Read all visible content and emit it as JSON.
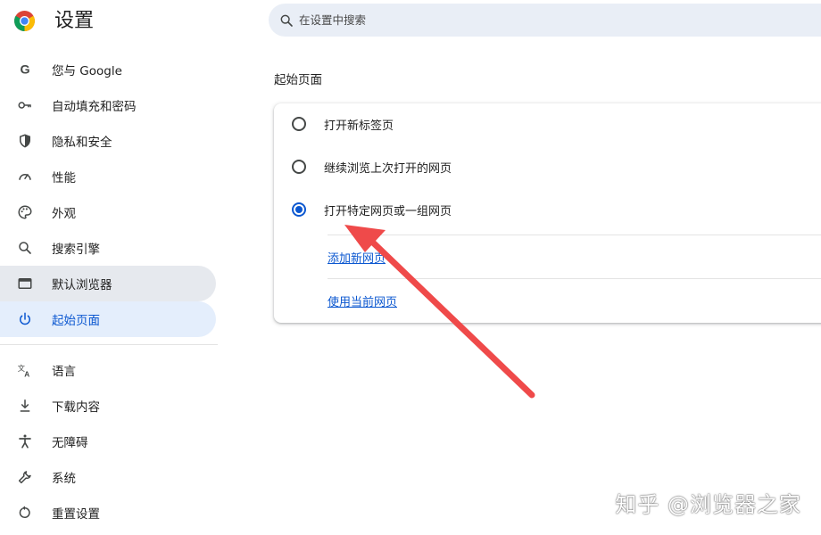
{
  "header": {
    "title": "设置",
    "search_placeholder": "在设置中搜索"
  },
  "sidebar": {
    "items": [
      {
        "label": "您与 Google",
        "icon": "google-g-icon"
      },
      {
        "label": "自动填充和密码",
        "icon": "key-icon"
      },
      {
        "label": "隐私和安全",
        "icon": "shield-icon"
      },
      {
        "label": "性能",
        "icon": "speedometer-icon"
      },
      {
        "label": "外观",
        "icon": "palette-icon"
      },
      {
        "label": "搜索引擎",
        "icon": "search-icon"
      },
      {
        "label": "默认浏览器",
        "icon": "browser-window-icon"
      },
      {
        "label": "起始页面",
        "icon": "power-icon"
      }
    ],
    "items2": [
      {
        "label": "语言",
        "icon": "translate-icon"
      },
      {
        "label": "下载内容",
        "icon": "download-icon"
      },
      {
        "label": "无障碍",
        "icon": "accessibility-icon"
      },
      {
        "label": "系统",
        "icon": "wrench-icon"
      },
      {
        "label": "重置设置",
        "icon": "reset-icon"
      }
    ]
  },
  "main": {
    "section_title": "起始页面",
    "options": [
      {
        "label": "打开新标签页",
        "checked": false
      },
      {
        "label": "继续浏览上次打开的网页",
        "checked": false
      },
      {
        "label": "打开特定网页或一组网页",
        "checked": true
      }
    ],
    "links": {
      "add_page": "添加新网页",
      "use_current": "使用当前网页"
    }
  },
  "watermark": "知乎 @浏览器之家",
  "colors": {
    "accent": "#0b57d0",
    "active_bg": "#e4eefc",
    "search_bg": "#e9eef6",
    "arrow": "#ef4a4a"
  }
}
